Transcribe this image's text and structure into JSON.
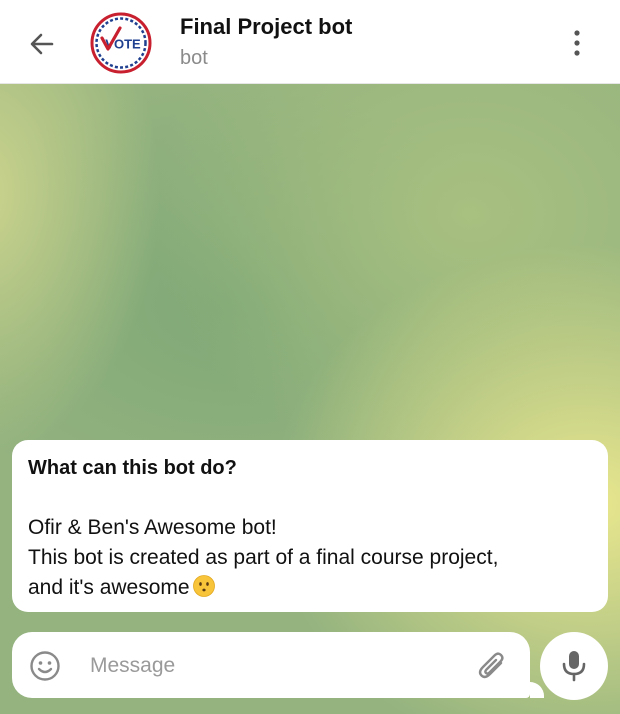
{
  "header": {
    "title": "Final Project bot",
    "subtitle": "bot",
    "back_icon": "arrow-left-icon",
    "menu_icon": "more-vertical-icon",
    "avatar_logo_text": "VOTE"
  },
  "chat": {
    "info_card": {
      "heading": "What can this bot do?",
      "lines": [
        "Ofir & Ben's Awesome bot!",
        "This bot is created as part of a final course project,",
        "and it's awesome"
      ],
      "emoji": "face-without-mouth-emoji"
    }
  },
  "composer": {
    "placeholder": "Message",
    "value": "",
    "emoji_icon": "smiley-icon",
    "attach_icon": "paperclip-icon",
    "mic_icon": "microphone-icon"
  },
  "colors": {
    "accent": "#8b8b8b",
    "vote_red": "#c8202f",
    "vote_blue": "#1f3f8f"
  }
}
